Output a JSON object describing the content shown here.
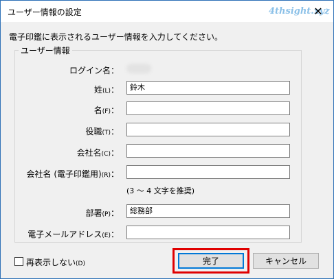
{
  "window": {
    "title": "ユーザー情報の設定",
    "watermark": "4thsight.xyz",
    "close_label": "✕"
  },
  "instruction": "電子印鑑に表示されるユーザー情報を入力してください。",
  "group": {
    "legend": "ユーザー情報",
    "login_label": "ログイン名：",
    "fields": [
      {
        "label": "姓",
        "accel": "(L)",
        "colon": "：",
        "value": "鈴木"
      },
      {
        "label": "名",
        "accel": "(F)",
        "colon": "：",
        "value": ""
      },
      {
        "label": "役職",
        "accel": "(T)",
        "colon": "：",
        "value": ""
      },
      {
        "label": "会社名",
        "accel": "(C)",
        "colon": "：",
        "value": ""
      },
      {
        "label": "会社名 (電子印鑑用)",
        "accel": "(R)",
        "colon": "：",
        "value": ""
      },
      {
        "label": "部署",
        "accel": "(P)",
        "colon": "：",
        "value": "総務部"
      },
      {
        "label": "電子メールアドレス",
        "accel": "(E)",
        "colon": "：",
        "value": ""
      }
    ],
    "hint": "(3 〜 4 文字を推奨)"
  },
  "footer": {
    "checkbox_label": "再表示しない",
    "checkbox_accel": "(D)",
    "done_label": "完了",
    "cancel_label": "キャンセル"
  },
  "colors": {
    "highlight": "#e00000",
    "default_button_border": "#0078d7",
    "watermark": "#8cc1e8"
  }
}
